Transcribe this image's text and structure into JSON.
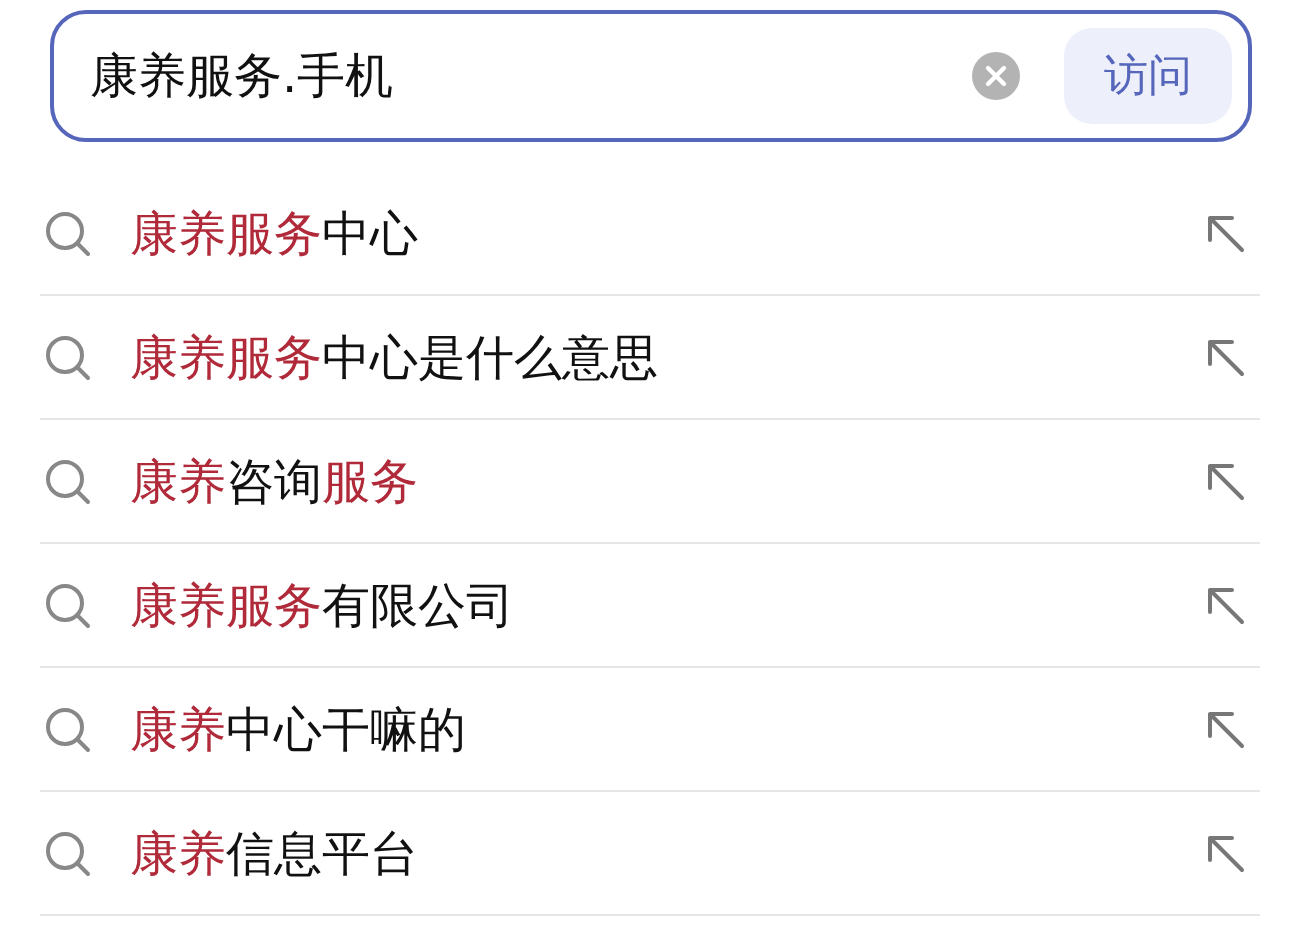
{
  "search": {
    "value": "康养服务.手机",
    "button": "访问"
  },
  "suggestions": [
    {
      "segments": [
        {
          "text": "康养服务",
          "match": true
        },
        {
          "text": "中心",
          "match": false
        }
      ]
    },
    {
      "segments": [
        {
          "text": "康养服务",
          "match": true
        },
        {
          "text": "中心是什么意思",
          "match": false
        }
      ]
    },
    {
      "segments": [
        {
          "text": "康养",
          "match": true
        },
        {
          "text": "咨询",
          "match": false
        },
        {
          "text": "服务",
          "match": true
        }
      ]
    },
    {
      "segments": [
        {
          "text": "康养服务",
          "match": true
        },
        {
          "text": "有限公司",
          "match": false
        }
      ]
    },
    {
      "segments": [
        {
          "text": "康养",
          "match": true
        },
        {
          "text": "中心干嘛的",
          "match": false
        }
      ]
    },
    {
      "segments": [
        {
          "text": "康养",
          "match": true
        },
        {
          "text": "信息平台",
          "match": false
        }
      ]
    }
  ]
}
